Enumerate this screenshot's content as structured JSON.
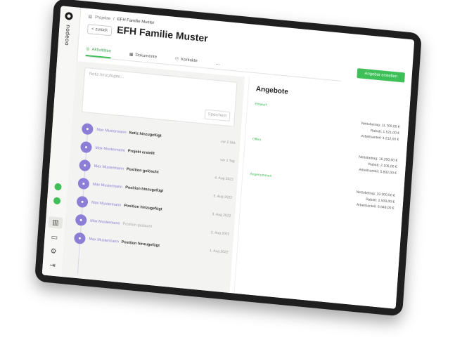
{
  "app": {
    "brand": "nodeoo"
  },
  "breadcrumb": {
    "parent": "Projekte",
    "current": "EFH Familie Muster"
  },
  "header": {
    "back_label": "< zurück",
    "title": "EFH Familie Muster",
    "cta_label": "Angebot erstellen"
  },
  "tabs": [
    {
      "label": "Aktivitäten",
      "icon": "activity-icon",
      "active": true
    },
    {
      "label": "Dokumente",
      "icon": "documents-icon",
      "active": false
    },
    {
      "label": "Kontakte",
      "icon": "contacts-icon",
      "active": false
    }
  ],
  "more_label": "...",
  "notes": {
    "placeholder": "Notiz hinzufügen...",
    "save_label": "Speichern"
  },
  "timeline": [
    {
      "user": "Max Mustermann",
      "action": "Notiz hinzugefügt",
      "date": "vor 2 Std.",
      "muted": false
    },
    {
      "user": "Max Mustermann",
      "action": "Projekt erstellt",
      "date": "vor 1 Tag",
      "muted": false
    },
    {
      "user": "Max Mustermann",
      "action": "Position gelöscht",
      "date": "4. Aug 2022",
      "muted": false
    },
    {
      "user": "Max Mustermann",
      "action": "Position hinzugefügt",
      "date": "3. Aug 2022",
      "muted": false
    },
    {
      "user": "Max Mustermann",
      "action": "Position hinzugefügt",
      "date": "3. Aug 2022",
      "muted": false
    },
    {
      "user": "Max Mustermann",
      "action": "Position gelöscht",
      "date": "2. Aug 2022",
      "muted": true
    },
    {
      "user": "Max Mustermann",
      "action": "Position hinzugefügt",
      "date": "1. Aug 2022",
      "muted": false
    }
  ],
  "offers": {
    "title": "Angebote",
    "items": [
      {
        "tag": "Entwurf",
        "lines": [
          "Nettobetrag: 11.700,00 €",
          "Rabatt: 1.521,00 €",
          "Arbeitsanteil: 4.212,00 €"
        ]
      },
      {
        "tag": "Offen",
        "lines": [
          "Nettobetrag: 16.200,00 €",
          "Rabatt: 2.106,00 €",
          "Arbeitsanteil: 5.832,00 €"
        ]
      },
      {
        "tag": "Angenommen",
        "lines": [
          "Nettobetrag: 19.300,00 €",
          "Rabatt: 2.509,00 €",
          "Arbeitsanteil: 6.948,00 €"
        ]
      }
    ]
  },
  "colors": {
    "accent": "#3fbf57",
    "timeline_avatar": "#8c7dd6",
    "device_frame": "#1f1f1f"
  }
}
